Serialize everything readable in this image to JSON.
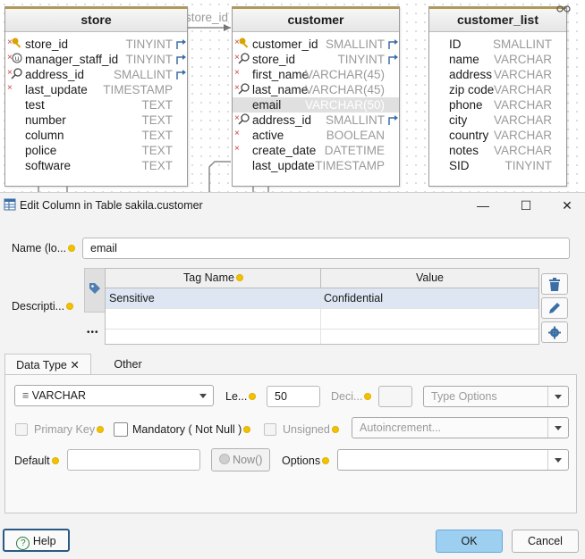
{
  "diagram": {
    "connector_label": "store_id",
    "tables": [
      {
        "name": "store",
        "columns": [
          {
            "name": "store_id",
            "type": "TINYINT",
            "icon": "key-icon",
            "mandatory": true,
            "fk": true
          },
          {
            "name": "manager_staff_id",
            "type": "TINYINT",
            "icon": "unique-index-icon",
            "mandatory": true,
            "fk": true
          },
          {
            "name": "address_id",
            "type": "SMALLINT",
            "icon": "index-icon",
            "mandatory": true,
            "fk": true
          },
          {
            "name": "last_update",
            "type": "TIMESTAMP",
            "mandatory": true
          },
          {
            "name": "test",
            "type": "TEXT"
          },
          {
            "name": "number",
            "type": "TEXT"
          },
          {
            "name": "column",
            "type": "TEXT"
          },
          {
            "name": "police",
            "type": "TEXT"
          },
          {
            "name": "software",
            "type": "TEXT"
          }
        ]
      },
      {
        "name": "customer",
        "columns": [
          {
            "name": "customer_id",
            "type": "SMALLINT",
            "icon": "key-icon",
            "mandatory": true,
            "fk": true
          },
          {
            "name": "store_id",
            "type": "TINYINT",
            "icon": "index-icon",
            "mandatory": true,
            "fk": true
          },
          {
            "name": "first_name",
            "type": "VARCHAR(45)",
            "mandatory": true
          },
          {
            "name": "last_name",
            "type": "VARCHAR(45)",
            "icon": "index-icon",
            "mandatory": true
          },
          {
            "name": "email",
            "type": "VARCHAR(50)",
            "selected": true
          },
          {
            "name": "address_id",
            "type": "SMALLINT",
            "icon": "index-icon",
            "mandatory": true,
            "fk": true
          },
          {
            "name": "active",
            "type": "BOOLEAN",
            "mandatory": true
          },
          {
            "name": "create_date",
            "type": "DATETIME",
            "mandatory": true
          },
          {
            "name": "last_update",
            "type": "TIMESTAMP"
          }
        ]
      },
      {
        "name": "customer_list",
        "columns": [
          {
            "name": "ID",
            "type": "SMALLINT"
          },
          {
            "name": "name",
            "type": "VARCHAR"
          },
          {
            "name": "address",
            "type": "VARCHAR"
          },
          {
            "name": "zip code",
            "type": "VARCHAR"
          },
          {
            "name": "phone",
            "type": "VARCHAR"
          },
          {
            "name": "city",
            "type": "VARCHAR"
          },
          {
            "name": "country",
            "type": "VARCHAR"
          },
          {
            "name": "notes",
            "type": "VARCHAR"
          },
          {
            "name": "SID",
            "type": "TINYINT"
          }
        ]
      }
    ]
  },
  "dialog": {
    "title": "Edit Column in Table sakila.customer",
    "minimize": "—",
    "maximize": "☐",
    "close": "✕",
    "name_label": "Name (lo...",
    "name_value": "email",
    "description_label": "Descripti...",
    "tags": {
      "headers": [
        "Tag Name",
        "Value"
      ],
      "rows": [
        {
          "name": "Sensitive",
          "value": "Confidential"
        }
      ],
      "more": "•••"
    },
    "tabs": [
      {
        "label": "Data Type",
        "close": "✕"
      },
      {
        "label": "Other"
      }
    ],
    "datatype": {
      "type_value": "VARCHAR",
      "length_label": "Le...",
      "length_value": "50",
      "decimal_label": "Deci...",
      "type_options_placeholder": "Type Options",
      "primary_key_label": "Primary Key",
      "mandatory_label": "Mandatory ( Not Null )",
      "unsigned_label": "Unsigned",
      "autoincrement_placeholder": "Autoincrement...",
      "default_label": "Default",
      "now_button": "Now()",
      "options_label": "Options"
    },
    "buttons": {
      "help": "Help",
      "ok": "OK",
      "cancel": "Cancel"
    }
  }
}
